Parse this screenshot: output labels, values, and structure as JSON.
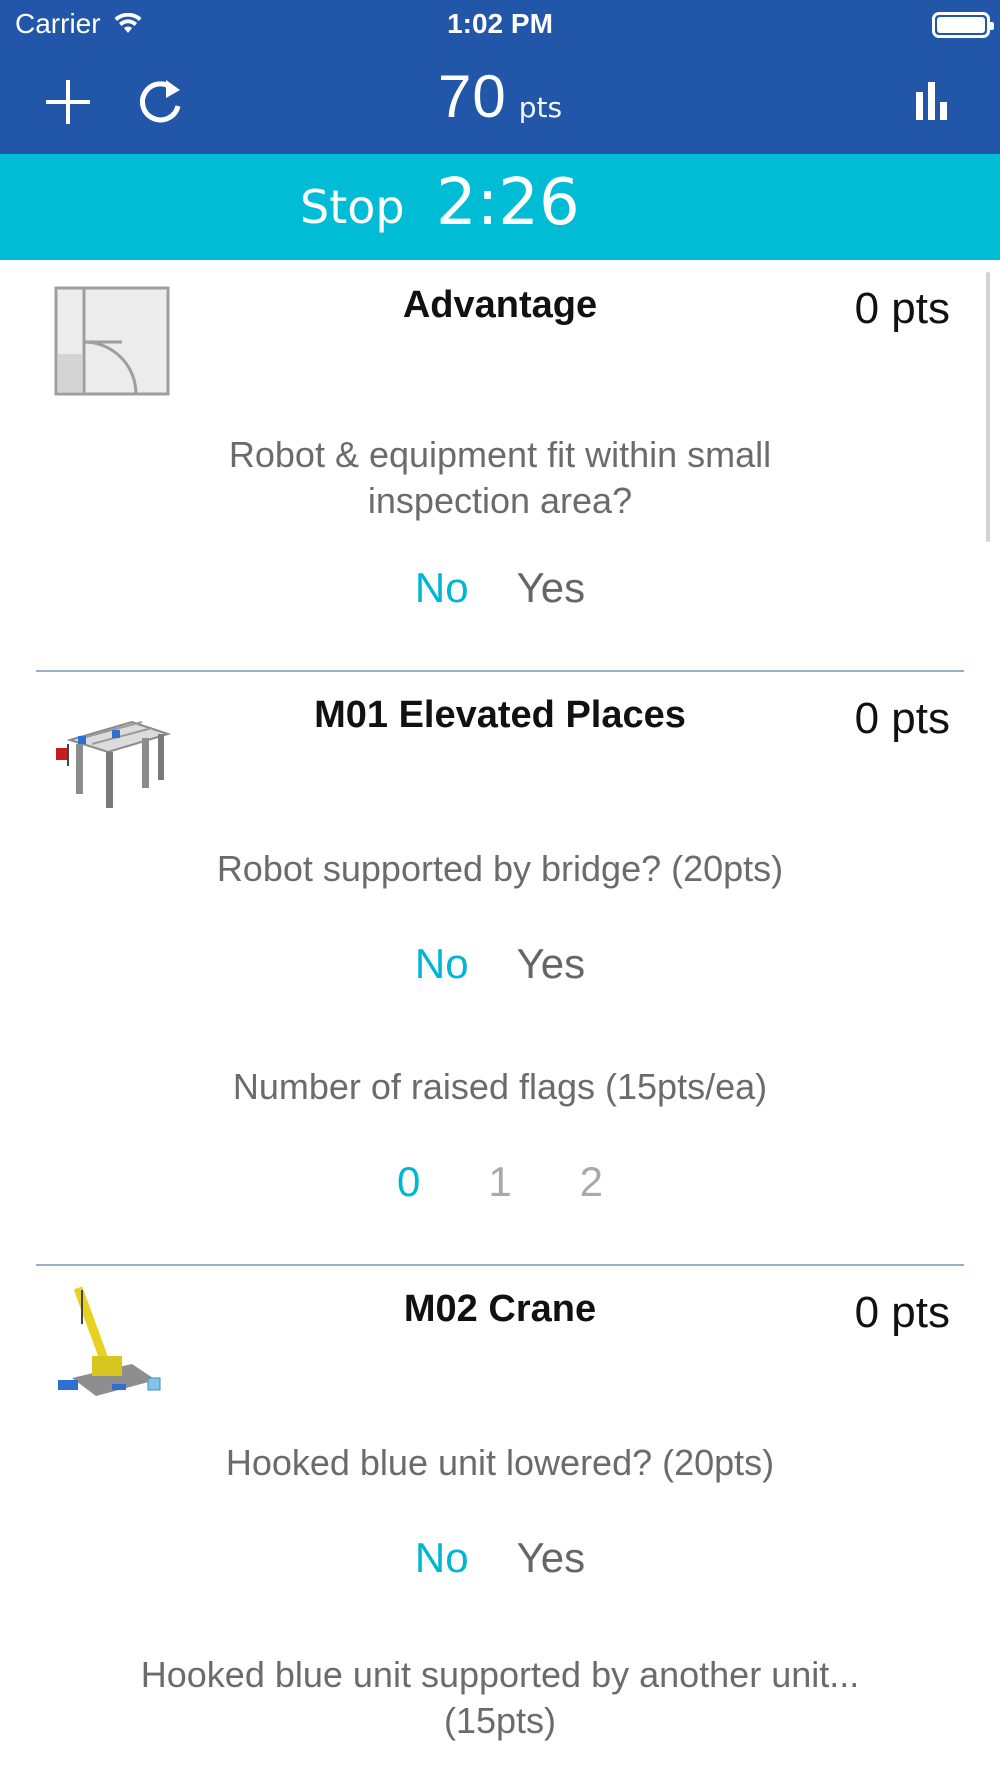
{
  "status": {
    "carrier": "Carrier",
    "time": "1:02 PM"
  },
  "header": {
    "score_value": "70",
    "score_unit": "pts"
  },
  "timer": {
    "stop_label": "Stop",
    "time": "2:26"
  },
  "colors": {
    "header": "#2156a9",
    "timer_bar": "#00bcd4",
    "selected": "#00b7d3"
  },
  "missions": [
    {
      "title": "Advantage",
      "points": "0 pts",
      "questions": [
        {
          "text_line1": "Robot & equipment fit within small",
          "text_line2": "inspection area?",
          "options": [
            "No",
            "Yes"
          ],
          "selected": "No"
        }
      ]
    },
    {
      "title": "M01 Elevated Places",
      "points": "0 pts",
      "questions": [
        {
          "text": "Robot supported by bridge? (20pts)",
          "options": [
            "No",
            "Yes"
          ],
          "selected": "No"
        },
        {
          "text": "Number of raised flags (15pts/ea)",
          "options": [
            "0",
            "1",
            "2"
          ],
          "selected": "0"
        }
      ]
    },
    {
      "title": "M02 Crane",
      "points": "0 pts",
      "questions": [
        {
          "text": "Hooked blue unit lowered? (20pts)",
          "options": [
            "No",
            "Yes"
          ],
          "selected": "No"
        },
        {
          "text_line1": "Hooked blue unit supported by another unit...",
          "text_line2": "(15pts)"
        }
      ]
    }
  ]
}
